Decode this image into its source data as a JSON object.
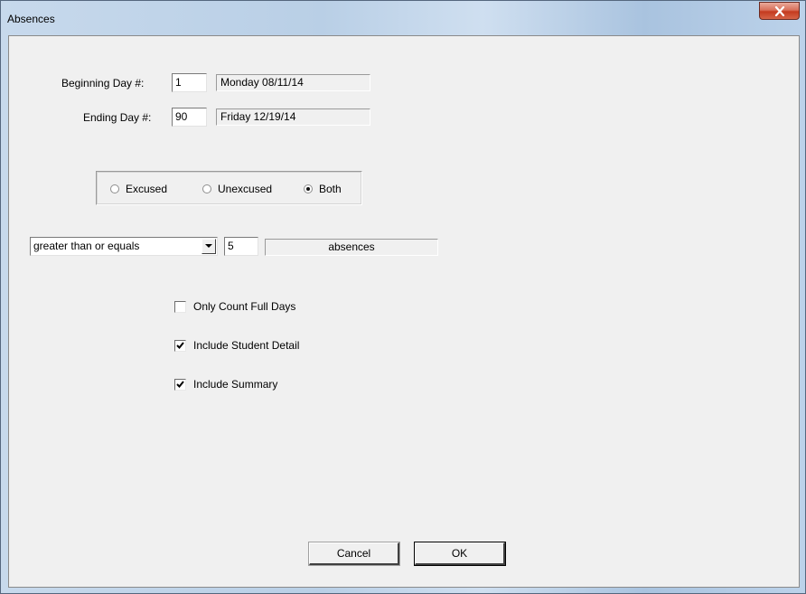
{
  "window": {
    "title": "Absences",
    "close_icon": "close-x-icon"
  },
  "date_range": {
    "beginning_label": "Beginning Day #:",
    "beginning_value": "1",
    "beginning_date": "Monday 08/11/14",
    "ending_label": "Ending Day #:",
    "ending_value": "90",
    "ending_date": "Friday 12/19/14"
  },
  "absence_type": {
    "options": [
      {
        "label": "Excused",
        "checked": false
      },
      {
        "label": "Unexcused",
        "checked": false
      },
      {
        "label": "Both",
        "checked": true
      }
    ]
  },
  "threshold": {
    "operator_selected": "greater than or equals",
    "count_value": "5",
    "unit_label": "absences"
  },
  "options": {
    "only_count_full_days": {
      "label": "Only Count Full Days",
      "checked": false
    },
    "include_student_detail": {
      "label": "Include Student Detail",
      "checked": true
    },
    "include_summary": {
      "label": "Include Summary",
      "checked": true
    }
  },
  "buttons": {
    "cancel_label": "Cancel",
    "ok_label": "OK"
  }
}
